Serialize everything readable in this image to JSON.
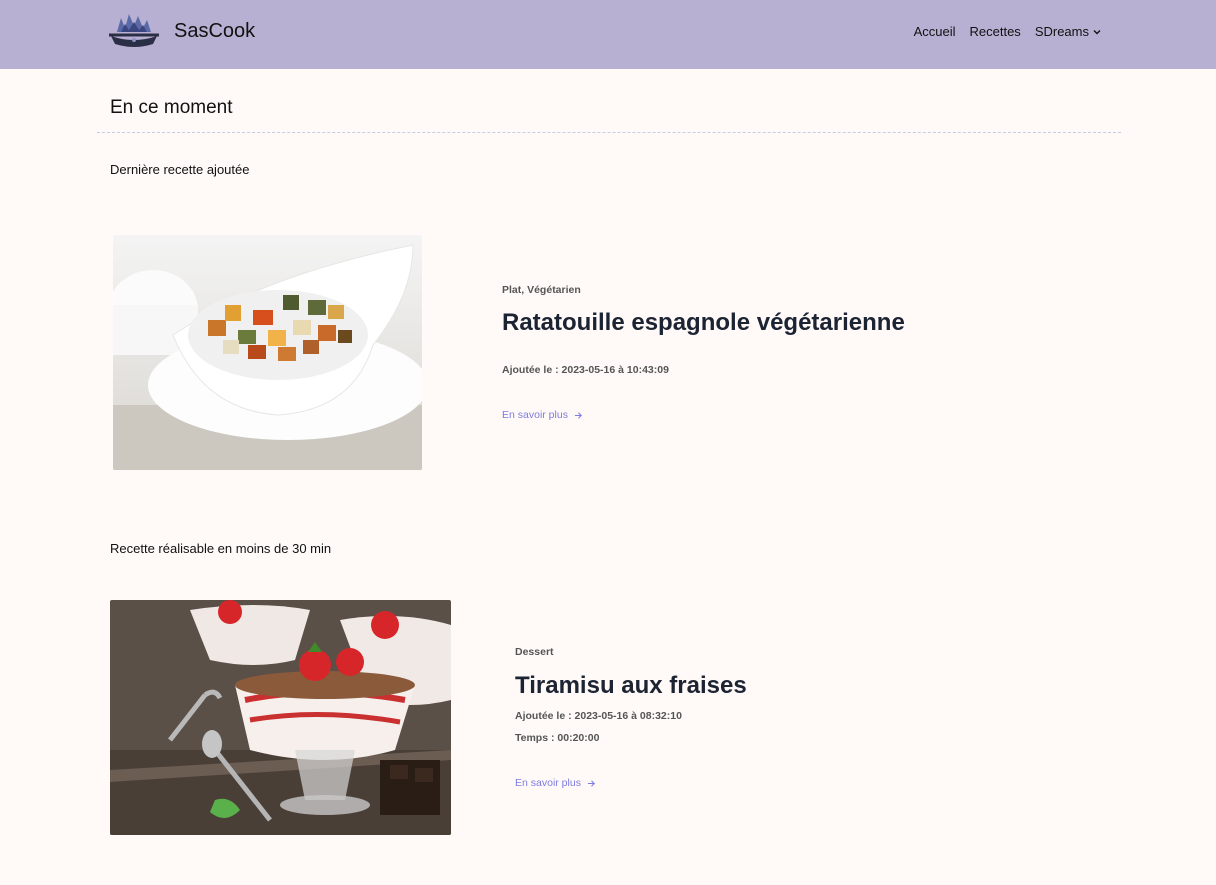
{
  "header": {
    "brand": "SasCook",
    "nav": {
      "home": "Accueil",
      "recipes": "Recettes",
      "sdreams": "SDreams"
    }
  },
  "section_title": "En ce moment",
  "latest": {
    "heading": "Dernière recette ajoutée",
    "tags": "Plat, Végétarien",
    "title": "Ratatouille espagnole végétarienne",
    "added": "Ajoutée le : 2023-05-16 à 10:43:09",
    "more": "En savoir plus"
  },
  "quick": {
    "heading": "Recette réalisable en moins de 30 min",
    "tags": "Dessert",
    "title": "Tiramisu aux fraises",
    "added": "Ajoutée le : 2023-05-16 à 08:32:10",
    "time": "Temps : 00:20:00",
    "more": "En savoir plus"
  },
  "colors": {
    "header_bg": "#b8b0d2",
    "page_bg": "#fffaf8",
    "link": "#7d7ce0"
  }
}
